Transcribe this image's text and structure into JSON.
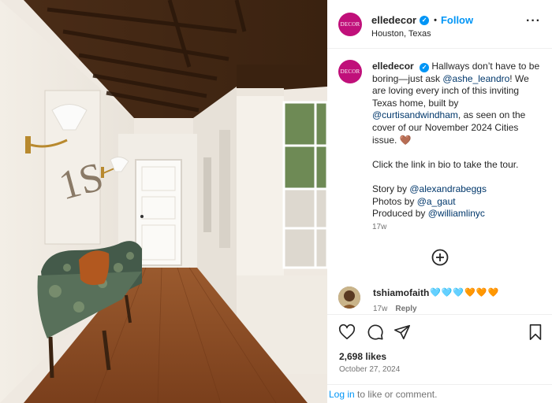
{
  "header": {
    "avatar_text": "DECOR",
    "username": "elledecor",
    "separator": "•",
    "follow_label": "Follow",
    "location": "Houston, Texas",
    "more_label": "···"
  },
  "caption": {
    "username": "elledecor",
    "line1_a": "Hallways don’t have to be boring—just ask ",
    "mention_architect": "@ashe_leandro",
    "line1_b": "! We are loving every inch of this inviting Texas home, built by ",
    "mention_builder": "@curtisandwindham",
    "line1_c": ", as seen on the cover of our November 2024 Cities issue. 🤎",
    "line2": "Click the link in bio to take the tour.",
    "story_label": "Story by ",
    "story_mention": "@alexandrabeggs",
    "photos_label": "Photos by ",
    "photos_mention": "@a_gaut",
    "produced_label": "Produced by ",
    "produced_mention": "@williamlinyc",
    "time_ago": "17w"
  },
  "comment": {
    "username": "tshiamofaith",
    "text": "🩵🩵🩵🧡🧡🧡",
    "time_ago": "17w",
    "reply_label": "Reply"
  },
  "stats": {
    "likes": "2,698 likes",
    "date": "October 27, 2024"
  },
  "footer": {
    "login_label": "Log in",
    "rest_text": " to like or comment."
  },
  "icons": {
    "like": "heart-icon",
    "comment": "comment-icon",
    "share": "paper-plane-icon",
    "save": "bookmark-icon",
    "add": "add-circle-icon"
  },
  "colors": {
    "brand": "#c0107a",
    "link": "#0095f6",
    "mention": "#00376b",
    "muted": "#737373"
  }
}
